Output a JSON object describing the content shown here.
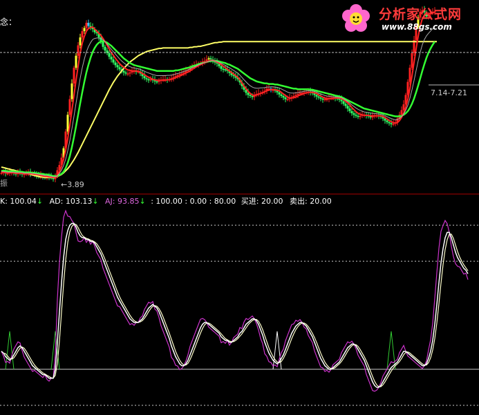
{
  "colors": {
    "background": "#000000",
    "candle_up": "#ff2020",
    "candle_down": "#33ff66",
    "candle_yellow": "#ffff33",
    "candle_cyan": "#33ccff",
    "ma_red": "#ff2222",
    "ma_green": "#33ff33",
    "ma_yellow": "#ffff66",
    "ma_gray": "#aaaaaa",
    "line_white": "#ffffff",
    "line_cream": "#ffffcc",
    "line_magenta": "#cc33cc",
    "spike_green": "#33cc33",
    "spike_white": "#ffffff",
    "level_line": "#cccccc",
    "divider": "#aa0000",
    "label_ad": "#ffffff",
    "label_aj": "#dd66dd",
    "arrow_green": "#33ff33"
  },
  "header": {
    "indicator_name": "念："
  },
  "annotations": {
    "low_price": "3.89",
    "range_label": "7.14-7.21",
    "left_tag": "振"
  },
  "logo": {
    "name": "分析家公式网",
    "url": "www.88gs.com",
    "icon": "flower-icon"
  },
  "indicator_header": {
    "k_label": "K: 100.04",
    "ad_label": "AD: 103.13",
    "aj_label": "AJ: 93.85",
    "levels_label": ": 100.00 : 0.00 : 80.00",
    "buy_label": "买进: 20.00",
    "sell_label": "卖出: 20.00"
  },
  "chart_data": [
    {
      "type": "candlestick",
      "title": "",
      "x": [
        0,
        3,
        6,
        9,
        12,
        15,
        18,
        21,
        24,
        27,
        30,
        33,
        36,
        39,
        42,
        45,
        48,
        51,
        54,
        57,
        60,
        63,
        66,
        69,
        72,
        75,
        78,
        81,
        84,
        87,
        90,
        93,
        96,
        99,
        102,
        105,
        108,
        111,
        114,
        117,
        120,
        123,
        126,
        129,
        132,
        135,
        138,
        141,
        144,
        147,
        150,
        153,
        156,
        159,
        162,
        165,
        168,
        171,
        174,
        177,
        180,
        183,
        186,
        189,
        192,
        195,
        198,
        201,
        204,
        207,
        210,
        213,
        216,
        219,
        222,
        225,
        228,
        231,
        234,
        237,
        240,
        243,
        246,
        249,
        252,
        255,
        258,
        261,
        264,
        267,
        270,
        273,
        276,
        279,
        282,
        285,
        288,
        291,
        294,
        297,
        300,
        303,
        306,
        309,
        312,
        315,
        318,
        321,
        324,
        327,
        330,
        333,
        336,
        339,
        342,
        345,
        348,
        351,
        354,
        357,
        360,
        363,
        366,
        369,
        372,
        375,
        378,
        381,
        384,
        387,
        390,
        393,
        396,
        399,
        402,
        405,
        408,
        411,
        414,
        417,
        420,
        423,
        426,
        429,
        432,
        435,
        438,
        441,
        444,
        447,
        450,
        453,
        456,
        459,
        462,
        465,
        468,
        471,
        474,
        477,
        480,
        483,
        486,
        489,
        492,
        495,
        498,
        501,
        504,
        507,
        510,
        513,
        516,
        519,
        522,
        525,
        528,
        531,
        534,
        537,
        540,
        543,
        546,
        549,
        552,
        555,
        558,
        561,
        564,
        567,
        570,
        573,
        576,
        579,
        582,
        585,
        588,
        591,
        594,
        597,
        600,
        603,
        606,
        609,
        612,
        615,
        618,
        621,
        624,
        627,
        630,
        633,
        636,
        639,
        642,
        645,
        648,
        651,
        654,
        657,
        660,
        663,
        666,
        669,
        672,
        675
      ],
      "close": [
        4.01,
        4.03,
        4.0,
        4.0,
        4.02,
        4.03,
        4.0,
        3.99,
        4.01,
        4.0,
        3.98,
        3.99,
        4.0,
        4.01,
        3.99,
        4.0,
        3.98,
        3.96,
        3.94,
        3.96,
        3.94,
        3.92,
        3.94,
        3.93,
        3.92,
        3.89,
        3.95,
        4.06,
        4.16,
        4.3,
        4.48,
        4.8,
        5.12,
        5.42,
        5.72,
        6.02,
        6.25,
        6.45,
        6.6,
        6.72,
        6.78,
        6.88,
        6.82,
        6.79,
        6.76,
        6.7,
        6.68,
        6.6,
        6.51,
        6.42,
        6.35,
        6.3,
        6.23,
        6.18,
        6.12,
        6.07,
        6.03,
        5.99,
        5.96,
        5.93,
        5.91,
        5.91,
        5.93,
        5.95,
        5.96,
        5.95,
        5.95,
        5.91,
        5.86,
        5.82,
        5.8,
        5.79,
        5.8,
        5.78,
        5.76,
        5.75,
        5.77,
        5.79,
        5.8,
        5.8,
        5.79,
        5.8,
        5.82,
        5.84,
        5.86,
        5.88,
        5.9,
        5.91,
        5.93,
        5.96,
        5.98,
        6.02,
        6.04,
        6.07,
        6.08,
        6.1,
        6.1,
        6.14,
        6.15,
        6.18,
        6.2,
        6.18,
        6.14,
        6.12,
        6.1,
        6.05,
        6.0,
        5.99,
        5.98,
        5.96,
        5.92,
        5.88,
        5.86,
        5.83,
        5.8,
        5.74,
        5.67,
        5.6,
        5.54,
        5.5,
        5.48,
        5.46,
        5.5,
        5.52,
        5.53,
        5.54,
        5.56,
        5.58,
        5.62,
        5.62,
        5.6,
        5.6,
        5.58,
        5.55,
        5.51,
        5.48,
        5.45,
        5.42,
        5.42,
        5.44,
        5.46,
        5.48,
        5.5,
        5.52,
        5.54,
        5.54,
        5.55,
        5.55,
        5.56,
        5.55,
        5.53,
        5.5,
        5.47,
        5.45,
        5.43,
        5.41,
        5.42,
        5.42,
        5.44,
        5.45,
        5.45,
        5.44,
        5.43,
        5.41,
        5.38,
        5.33,
        5.29,
        5.24,
        5.19,
        5.15,
        5.12,
        5.1,
        5.09,
        5.1,
        5.12,
        5.12,
        5.11,
        5.09,
        5.08,
        5.09,
        5.11,
        5.11,
        5.1,
        5.08,
        5.05,
        5.01,
        4.98,
        4.96,
        4.94,
        4.95,
        4.98,
        5.05,
        5.12,
        5.21,
        5.32,
        5.5,
        5.75,
        6.02,
        6.3,
        6.55,
        6.8,
        6.98,
        7.09,
        7.12,
        7.08,
        7.0,
        7.04,
        7.08,
        7.09,
        7.1
      ],
      "ma_red": [
        4.02,
        4.02,
        4.01,
        4.01,
        4.01,
        4.01,
        4.01,
        4.0,
        4.0,
        4.0,
        4.0,
        3.99,
        3.99,
        3.99,
        3.99,
        3.99,
        3.98,
        3.98,
        3.97,
        3.96,
        3.95,
        3.94,
        3.94,
        3.93,
        3.93,
        3.92,
        3.92,
        3.96,
        4.03,
        4.13,
        4.27,
        4.44,
        4.66,
        4.92,
        5.2,
        5.49,
        5.78,
        6.05,
        6.3,
        6.49,
        6.62,
        6.72,
        6.77,
        6.79,
        6.8,
        6.76,
        6.72,
        6.68,
        6.64,
        6.58,
        6.52,
        6.45,
        6.38,
        6.31,
        6.26,
        6.2,
        6.15,
        6.1,
        6.06,
        6.03,
        6.0,
        5.98,
        5.97,
        5.96,
        5.96,
        5.96,
        5.95,
        5.94,
        5.91,
        5.89,
        5.86,
        5.84,
        5.82,
        5.8,
        5.79,
        5.78,
        5.78,
        5.78,
        5.78,
        5.78,
        5.79,
        5.79,
        5.8,
        5.81,
        5.83,
        5.85,
        5.86,
        5.88,
        5.9,
        5.92,
        5.94,
        5.96,
        5.99,
        6.01,
        6.04,
        6.06,
        6.08,
        6.1,
        6.12,
        6.13,
        6.15,
        6.16,
        6.16,
        6.15,
        6.13,
        6.11,
        6.08,
        6.05,
        6.02,
        5.99,
        5.96,
        5.93,
        5.9,
        5.87,
        5.84,
        5.79,
        5.73,
        5.67,
        5.62,
        5.57,
        5.53,
        5.5,
        5.49,
        5.5,
        5.51,
        5.53,
        5.54,
        5.56,
        5.58,
        5.59,
        5.6,
        5.6,
        5.6,
        5.59,
        5.58,
        5.55,
        5.52,
        5.49,
        5.46,
        5.44,
        5.44,
        5.45,
        5.46,
        5.48,
        5.5,
        5.51,
        5.53,
        5.54,
        5.55,
        5.55,
        5.55,
        5.54,
        5.53,
        5.5,
        5.48,
        5.46,
        5.44,
        5.43,
        5.43,
        5.43,
        5.43,
        5.44,
        5.44,
        5.44,
        5.43,
        5.41,
        5.38,
        5.35,
        5.31,
        5.26,
        5.22,
        5.18,
        5.15,
        5.13,
        5.12,
        5.11,
        5.11,
        5.11,
        5.1,
        5.1,
        5.1,
        5.1,
        5.1,
        5.1,
        5.09,
        5.07,
        5.04,
        5.01,
        4.99,
        4.97,
        4.96,
        4.97,
        5.01,
        5.07,
        5.15,
        5.26,
        5.41,
        5.62,
        5.86,
        6.12,
        6.38,
        6.62,
        6.82,
        6.96,
        7.03,
        7.05,
        7.05,
        7.06,
        7.07,
        7.08
      ],
      "ma_green": [
        4.05,
        4.05,
        4.05,
        4.04,
        4.04,
        4.04,
        4.04,
        4.03,
        4.03,
        4.03,
        4.03,
        4.02,
        4.02,
        4.02,
        4.02,
        4.01,
        4.01,
        4.0,
        4.0,
        3.99,
        3.99,
        3.98,
        3.98,
        3.97,
        3.96,
        3.95,
        3.95,
        3.95,
        3.97,
        3.99,
        4.03,
        4.1,
        4.2,
        4.33,
        4.5,
        4.69,
        4.9,
        5.12,
        5.34,
        5.55,
        5.75,
        5.93,
        6.08,
        6.21,
        6.32,
        6.4,
        6.46,
        6.5,
        6.52,
        6.53,
        6.52,
        6.5,
        6.47,
        6.44,
        6.4,
        6.36,
        6.32,
        6.28,
        6.24,
        6.2,
        6.17,
        6.14,
        6.11,
        6.09,
        6.07,
        6.06,
        6.05,
        6.04,
        6.03,
        6.02,
        6.01,
        6.0,
        5.99,
        5.98,
        5.97,
        5.96,
        5.96,
        5.96,
        5.96,
        5.96,
        5.96,
        5.96,
        5.96,
        5.96,
        5.97,
        5.97,
        5.98,
        5.99,
        6.0,
        6.01,
        6.02,
        6.03,
        6.05,
        6.06,
        6.07,
        6.09,
        6.1,
        6.11,
        6.12,
        6.13,
        6.14,
        6.15,
        6.15,
        6.15,
        6.15,
        6.14,
        6.13,
        6.12,
        6.11,
        6.09,
        6.08,
        6.06,
        6.04,
        6.02,
        6.0,
        5.97,
        5.94,
        5.91,
        5.88,
        5.85,
        5.82,
        5.8,
        5.78,
        5.76,
        5.75,
        5.74,
        5.73,
        5.72,
        5.72,
        5.71,
        5.71,
        5.71,
        5.7,
        5.7,
        5.69,
        5.68,
        5.67,
        5.66,
        5.65,
        5.64,
        5.63,
        5.62,
        5.62,
        5.61,
        5.61,
        5.61,
        5.61,
        5.61,
        5.61,
        5.6,
        5.6,
        5.59,
        5.58,
        5.57,
        5.56,
        5.55,
        5.54,
        5.53,
        5.52,
        5.51,
        5.5,
        5.49,
        5.48,
        5.47,
        5.46,
        5.44,
        5.42,
        5.4,
        5.38,
        5.36,
        5.34,
        5.32,
        5.3,
        5.28,
        5.26,
        5.24,
        5.23,
        5.22,
        5.21,
        5.2,
        5.19,
        5.18,
        5.17,
        5.16,
        5.15,
        5.14,
        5.13,
        5.12,
        5.11,
        5.1,
        5.09,
        5.09,
        5.09,
        5.1,
        5.12,
        5.15,
        5.19,
        5.25,
        5.33,
        5.43,
        5.55,
        5.68,
        5.82,
        5.96,
        6.09,
        6.21,
        6.31,
        6.39,
        6.46,
        6.52
      ],
      "ma_yellow": [
        4.12,
        4.11,
        4.1,
        4.09,
        4.08,
        4.07,
        4.06,
        4.05,
        4.04,
        4.03,
        4.02,
        4.01,
        4.0,
        3.99,
        3.98,
        3.97,
        3.96,
        3.95,
        3.94,
        3.93,
        3.93,
        3.92,
        3.92,
        3.92,
        3.92,
        3.92,
        3.93,
        3.94,
        3.96,
        3.98,
        4.01,
        4.05,
        4.09,
        4.14,
        4.2,
        4.26,
        4.33,
        4.4,
        4.48,
        4.56,
        4.64,
        4.72,
        4.8,
        4.88,
        4.96,
        5.04,
        5.12,
        5.2,
        5.28,
        5.36,
        5.44,
        5.52,
        5.6,
        5.67,
        5.74,
        5.8,
        5.86,
        5.91,
        5.96,
        6.01,
        6.05,
        6.09,
        6.13,
        6.16,
        6.19,
        6.22,
        6.25,
        6.27,
        6.29,
        6.31,
        6.33,
        6.34,
        6.35,
        6.36,
        6.37,
        6.38,
        6.39,
        6.39,
        6.4,
        6.4,
        6.4,
        6.4,
        6.4,
        6.4,
        6.4,
        6.4,
        6.4,
        6.4,
        6.4,
        6.4,
        6.4,
        6.41,
        6.41,
        6.42,
        6.42,
        6.43,
        6.43,
        6.44,
        6.45,
        6.46,
        6.47,
        6.48,
        6.49,
        6.5,
        6.5,
        6.51,
        6.51,
        6.52,
        6.52,
        6.52,
        6.52,
        6.52,
        6.52,
        6.52,
        6.52,
        6.52,
        6.52,
        6.52,
        6.52,
        6.52,
        6.52,
        6.52,
        6.52,
        6.52,
        6.52,
        6.52,
        6.52,
        6.52,
        6.52,
        6.52,
        6.52,
        6.52,
        6.52,
        6.52,
        6.52,
        6.52,
        6.52,
        6.52,
        6.52,
        6.52,
        6.52,
        6.52,
        6.52,
        6.52,
        6.52,
        6.52,
        6.52,
        6.52,
        6.52,
        6.52,
        6.52,
        6.52,
        6.52,
        6.52,
        6.52,
        6.52,
        6.52,
        6.52,
        6.52,
        6.52,
        6.52,
        6.52,
        6.52,
        6.52,
        6.52,
        6.52,
        6.52,
        6.52,
        6.52,
        6.52,
        6.52,
        6.52,
        6.52,
        6.52,
        6.52,
        6.52,
        6.52,
        6.52,
        6.52,
        6.52,
        6.52,
        6.52,
        6.52,
        6.52,
        6.52,
        6.52,
        6.52,
        6.52,
        6.52,
        6.52,
        6.52,
        6.52,
        6.52,
        6.52,
        6.52,
        6.52,
        6.52,
        6.52,
        6.52,
        6.52,
        6.52,
        6.52,
        6.52,
        6.52,
        6.52,
        6.52,
        6.52,
        6.52,
        6.52,
        6.52,
        6.52
      ],
      "ylim": [
        3.75,
        7.25
      ]
    },
    {
      "type": "line",
      "title": "",
      "x_count": 226,
      "series_k": [
        30,
        29,
        27,
        26,
        25,
        26,
        28,
        30,
        32,
        33,
        32,
        30,
        28,
        26,
        24,
        22,
        21,
        20,
        19,
        18,
        17,
        17,
        16,
        15,
        15,
        15,
        20,
        35,
        52,
        68,
        82,
        92,
        97,
        100,
        101,
        101,
        99,
        96,
        94,
        93,
        93,
        92,
        92,
        91,
        91,
        90,
        88,
        86,
        84,
        81,
        78,
        75,
        72,
        69,
        66,
        63,
        60,
        58,
        56,
        54,
        52,
        50,
        48,
        47,
        46,
        46,
        46,
        47,
        48,
        50,
        52,
        54,
        55,
        56,
        55,
        54,
        52,
        49,
        46,
        43,
        40,
        37,
        33,
        30,
        27,
        25,
        23,
        22,
        22,
        23,
        25,
        28,
        31,
        34,
        37,
        40,
        43,
        45,
        46,
        46,
        45,
        44,
        43,
        42,
        41,
        40,
        38,
        37,
        36,
        36,
        35,
        35,
        36,
        37,
        38,
        40,
        41,
        43,
        45,
        46,
        47,
        48,
        48,
        47,
        45,
        42,
        39,
        35,
        32,
        29,
        27,
        25,
        24,
        23,
        24,
        26,
        28,
        31,
        34,
        37,
        40,
        42,
        44,
        45,
        46,
        46,
        45,
        44,
        42,
        40,
        38,
        35,
        32,
        29,
        26,
        24,
        22,
        21,
        20,
        20,
        21,
        22,
        23,
        24,
        26,
        28,
        30,
        32,
        33,
        34,
        34,
        33,
        31,
        29,
        27,
        25,
        22,
        19,
        16,
        13,
        11,
        10,
        10,
        11,
        13,
        15,
        17,
        19,
        21,
        22,
        23,
        24,
        26,
        28,
        30,
        30,
        29,
        28,
        27,
        26,
        25,
        24,
        23,
        22,
        22,
        23,
        26,
        30,
        36,
        45,
        56,
        68,
        79,
        87,
        93,
        96,
        96,
        93,
        89,
        85,
        82,
        80,
        78,
        76,
        75,
        73
      ],
      "levels": [
        100,
        80,
        20,
        0
      ],
      "ylim": [
        -5,
        110
      ]
    }
  ]
}
